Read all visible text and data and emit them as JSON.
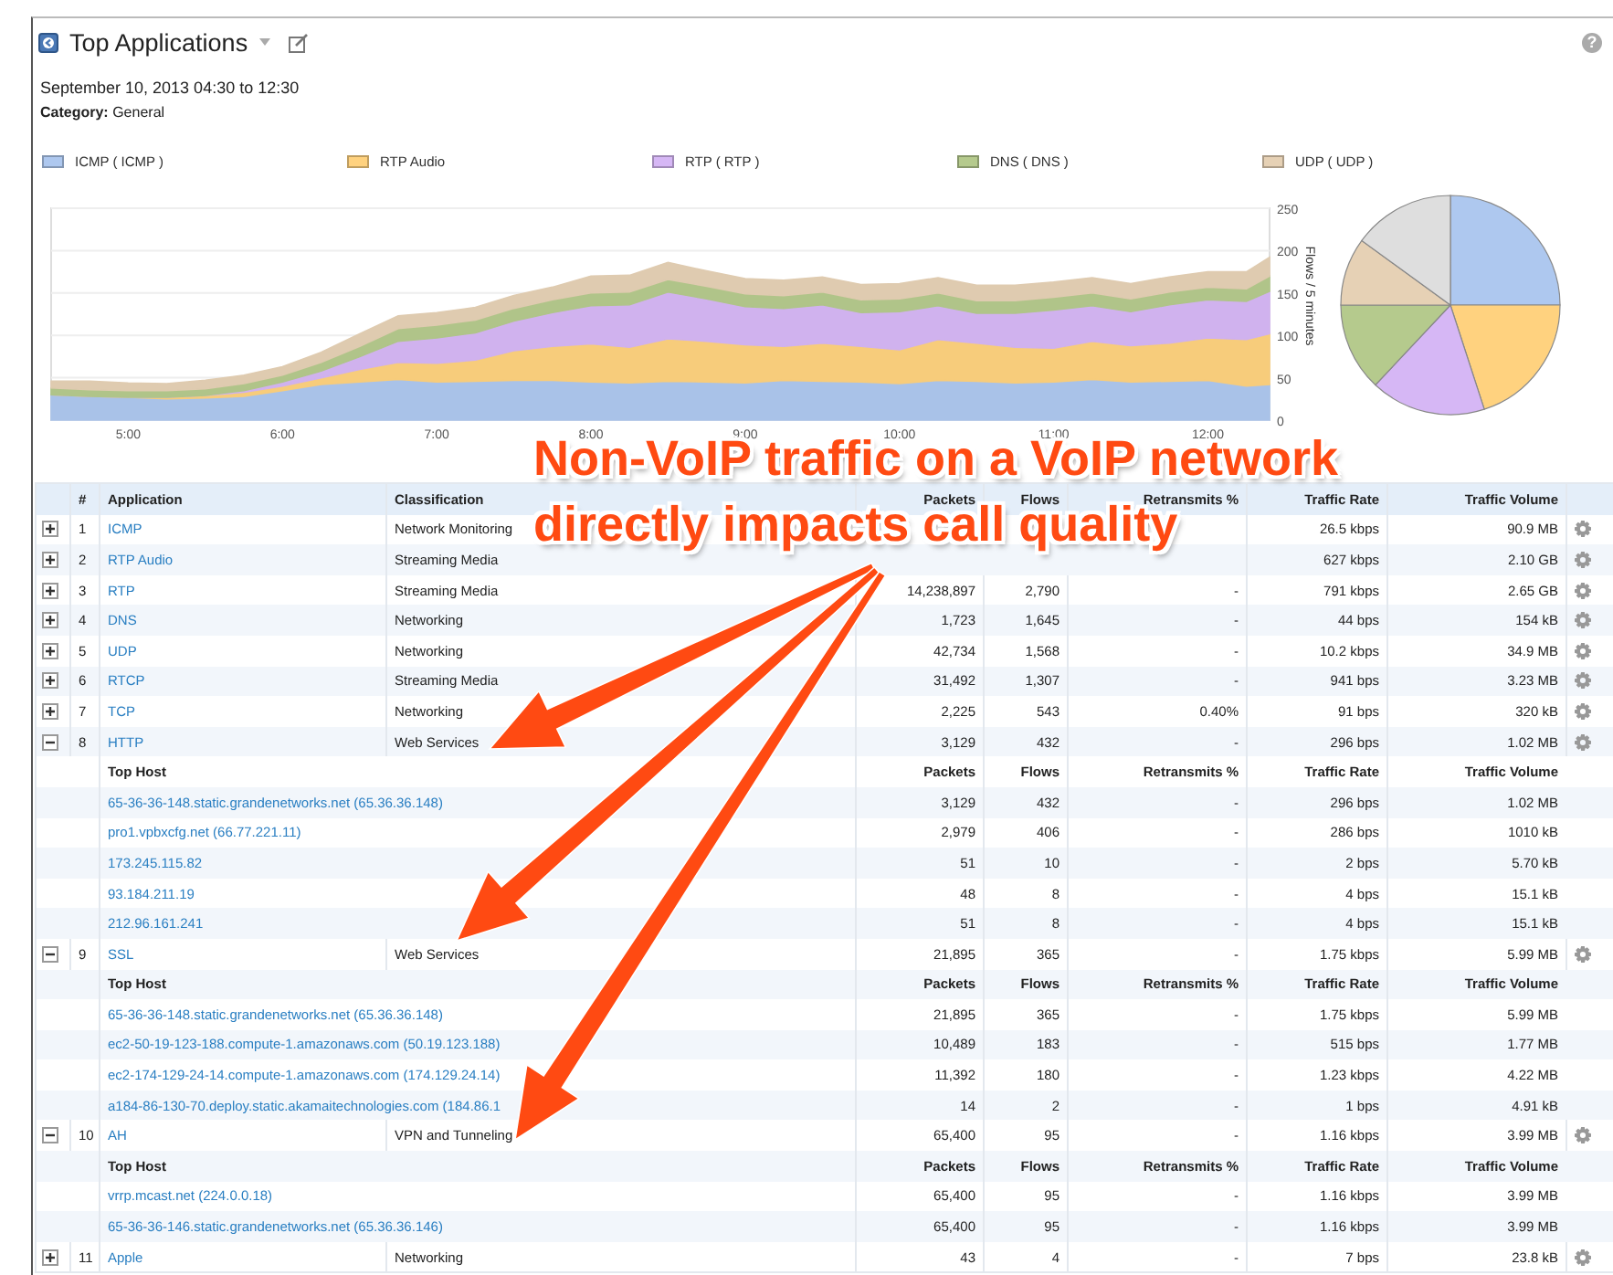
{
  "header": {
    "title": "Top Applications",
    "help": "?",
    "date_range": "September 10, 2013 04:30 to 12:30",
    "category_label": "Category:",
    "category_value": "General"
  },
  "chart": {
    "chart_data": {
      "type": "area",
      "stacked": true,
      "grid": true,
      "ylabel": "Flows / 5 minutes",
      "ylim": [
        0,
        250
      ],
      "yticks": [
        0,
        50,
        100,
        150,
        200,
        250
      ],
      "xlim": [
        4.5,
        12.4
      ],
      "xticks": [
        {
          "value": 5,
          "label": "5:00"
        },
        {
          "value": 6,
          "label": "6:00"
        },
        {
          "value": 7,
          "label": "7:00"
        },
        {
          "value": 8,
          "label": "8:00"
        },
        {
          "value": 9,
          "label": "9:00"
        },
        {
          "value": 10,
          "label": "10:00"
        },
        {
          "value": 11,
          "label": "11:00"
        },
        {
          "value": 12,
          "label": "12:00"
        }
      ],
      "x": [
        4.5,
        4.75,
        5,
        5.25,
        5.5,
        5.75,
        6,
        6.25,
        6.5,
        6.75,
        7,
        7.25,
        7.5,
        7.75,
        8,
        8.25,
        8.5,
        8.75,
        9,
        9.25,
        9.5,
        9.75,
        10,
        10.25,
        10.5,
        10.75,
        11,
        11.25,
        11.5,
        11.75,
        12,
        12.25,
        12.4
      ],
      "series": [
        {
          "name": "ICMP ( ICMP )",
          "color": "#aec8ef",
          "values": [
            30,
            28,
            27,
            25,
            26,
            28,
            35,
            42,
            45,
            48,
            45,
            46,
            47,
            47,
            45,
            44,
            46,
            45,
            44,
            47,
            46,
            45,
            43,
            47,
            46,
            44,
            45,
            48,
            45,
            46,
            47,
            40,
            42
          ]
        },
        {
          "name": "RTP Audio",
          "color": "#ffd27f",
          "values": [
            0,
            0,
            0,
            2,
            3,
            5,
            5,
            8,
            15,
            20,
            22,
            25,
            35,
            40,
            45,
            42,
            50,
            48,
            45,
            40,
            45,
            42,
            40,
            48,
            45,
            42,
            40,
            45,
            43,
            45,
            50,
            55,
            60
          ]
        },
        {
          "name": "RTP ( RTP )",
          "color": "#d6b7f5",
          "values": [
            0,
            0,
            0,
            0,
            0,
            2,
            5,
            8,
            15,
            25,
            30,
            32,
            35,
            40,
            45,
            50,
            55,
            50,
            45,
            45,
            45,
            40,
            45,
            40,
            35,
            40,
            45,
            42,
            40,
            45,
            45,
            45,
            50
          ]
        },
        {
          "name": "DNS ( DNS )",
          "color": "#b5ca8d",
          "values": [
            8,
            8,
            8,
            8,
            8,
            8,
            8,
            10,
            12,
            15,
            15,
            15,
            15,
            15,
            15,
            15,
            15,
            15,
            15,
            15,
            15,
            15,
            15,
            15,
            15,
            15,
            15,
            15,
            15,
            15,
            15,
            15,
            18
          ]
        },
        {
          "name": "UDP ( UDP )",
          "color": "#e6d1b5",
          "values": [
            8,
            10,
            9,
            8,
            10,
            10,
            10,
            12,
            15,
            15,
            15,
            15,
            15,
            15,
            20,
            20,
            20,
            18,
            18,
            18,
            18,
            18,
            18,
            18,
            18,
            18,
            18,
            18,
            18,
            18,
            18,
            20,
            22
          ]
        }
      ]
    }
  },
  "table": {
    "columns": [
      "#",
      "Application",
      "Classification",
      "Packets",
      "Flows",
      "Retransmits %",
      "Traffic Rate",
      "Traffic Volume"
    ],
    "rows": [
      {
        "number": "1",
        "application": "ICMP",
        "classification": "Network Monitoring",
        "rate": "26.5 kbps",
        "volume": "90.9 MB",
        "expanded": false
      },
      {
        "number": "2",
        "application": "RTP Audio",
        "classification": "Streaming Media",
        "rate": "627 kbps",
        "volume": "2.10 GB",
        "expanded": false
      },
      {
        "number": "3",
        "application": "RTP",
        "classification": "Streaming Media",
        "packets": "14,238,897",
        "flows": "2,790",
        "retransmits": "-",
        "rate": "791 kbps",
        "volume": "2.65 GB",
        "expanded": false
      },
      {
        "number": "4",
        "application": "DNS",
        "classification": "Networking",
        "packets": "1,723",
        "flows": "1,645",
        "retransmits": "-",
        "rate": "44 bps",
        "volume": "154 kB",
        "expanded": false
      },
      {
        "number": "5",
        "application": "UDP",
        "classification": "Networking",
        "packets": "42,734",
        "flows": "1,568",
        "retransmits": "-",
        "rate": "10.2 kbps",
        "volume": "34.9 MB",
        "expanded": false
      },
      {
        "number": "6",
        "application": "RTCP",
        "classification": "Streaming Media",
        "packets": "31,492",
        "flows": "1,307",
        "retransmits": "-",
        "rate": "941 bps",
        "volume": "3.23 MB",
        "expanded": false
      },
      {
        "number": "7",
        "application": "TCP",
        "classification": "Networking",
        "packets": "2,225",
        "flows": "543",
        "retransmits": "0.40%",
        "rate": "91 bps",
        "volume": "320 kB",
        "expanded": false
      },
      {
        "number": "8",
        "application": "HTTP",
        "classification": "Web Services",
        "packets": "3,129",
        "flows": "432",
        "retransmits": "-",
        "rate": "296 bps",
        "volume": "1.02 MB",
        "expanded": true,
        "host_columns": [
          "Top Host",
          "Packets",
          "Flows",
          "Retransmits %",
          "Traffic Rate",
          "Traffic Volume"
        ],
        "hosts": [
          {
            "host": "65-36-36-148.static.grandenetworks.net (65.36.36.148)",
            "packets": "3,129",
            "flows": "432",
            "retransmits": "-",
            "rate": "296 bps",
            "volume": "1.02 MB"
          },
          {
            "host": "pro1.vpbxcfg.net (66.77.221.11)",
            "packets": "2,979",
            "flows": "406",
            "retransmits": "-",
            "rate": "286 bps",
            "volume": "1010 kB"
          },
          {
            "host": "173.245.115.82",
            "packets": "51",
            "flows": "10",
            "retransmits": "-",
            "rate": "2 bps",
            "volume": "5.70 kB"
          },
          {
            "host": "93.184.211.19",
            "packets": "48",
            "flows": "8",
            "retransmits": "-",
            "rate": "4 bps",
            "volume": "15.1 kB"
          },
          {
            "host": "212.96.161.241",
            "packets": "51",
            "flows": "8",
            "retransmits": "-",
            "rate": "4 bps",
            "volume": "15.1 kB"
          }
        ]
      },
      {
        "number": "9",
        "application": "SSL",
        "classification": "Web Services",
        "packets": "21,895",
        "flows": "365",
        "retransmits": "-",
        "rate": "1.75 kbps",
        "volume": "5.99 MB",
        "expanded": true,
        "host_columns": [
          "Top Host",
          "Packets",
          "Flows",
          "Retransmits %",
          "Traffic Rate",
          "Traffic Volume"
        ],
        "hosts": [
          {
            "host": "65-36-36-148.static.grandenetworks.net (65.36.36.148)",
            "packets": "21,895",
            "flows": "365",
            "retransmits": "-",
            "rate": "1.75 kbps",
            "volume": "5.99 MB"
          },
          {
            "host": "ec2-50-19-123-188.compute-1.amazonaws.com (50.19.123.188)",
            "packets": "10,489",
            "flows": "183",
            "retransmits": "-",
            "rate": "515 bps",
            "volume": "1.77 MB"
          },
          {
            "host": "ec2-174-129-24-14.compute-1.amazonaws.com (174.129.24.14)",
            "packets": "11,392",
            "flows": "180",
            "retransmits": "-",
            "rate": "1.23 kbps",
            "volume": "4.22 MB"
          },
          {
            "host": "a184-86-130-70.deploy.static.akamaitechnologies.com (184.86.1",
            "packets": "14",
            "flows": "2",
            "retransmits": "-",
            "rate": "1 bps",
            "volume": "4.91 kB"
          }
        ]
      },
      {
        "number": "10",
        "application": "AH",
        "classification": "VPN and Tunneling",
        "packets": "65,400",
        "flows": "95",
        "retransmits": "-",
        "rate": "1.16 kbps",
        "volume": "3.99 MB",
        "expanded": true,
        "host_columns": [
          "Top Host",
          "Packets",
          "Flows",
          "Retransmits %",
          "Traffic Rate",
          "Traffic Volume"
        ],
        "hosts": [
          {
            "host": "vrrp.mcast.net (224.0.0.18)",
            "packets": "65,400",
            "flows": "95",
            "retransmits": "-",
            "rate": "1.16 kbps",
            "volume": "3.99 MB"
          },
          {
            "host": "65-36-36-146.static.grandenetworks.net (65.36.36.146)",
            "packets": "65,400",
            "flows": "95",
            "retransmits": "-",
            "rate": "1.16 kbps",
            "volume": "3.99 MB"
          }
        ]
      },
      {
        "number": "11",
        "application": "Apple",
        "classification": "Networking",
        "packets": "43",
        "flows": "4",
        "retransmits": "-",
        "rate": "7 bps",
        "volume": "23.8 kB",
        "expanded": false
      }
    ]
  },
  "annotation": {
    "lines": [
      "Non-VoIP traffic on a VoIP network",
      "directly impacts call quality"
    ]
  }
}
